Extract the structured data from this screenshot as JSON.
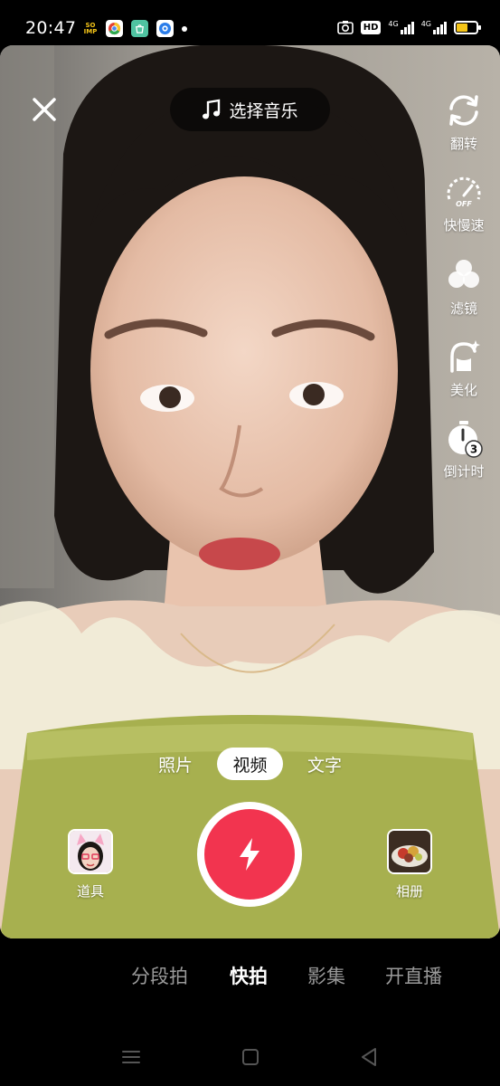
{
  "status_bar": {
    "time": "20:47",
    "soimp_label": "SO IMP",
    "hd_label": "HD",
    "network_1": "4G",
    "network_2": "4G",
    "battery_fraction": 0.55,
    "battery_color": "#f5c518"
  },
  "camera": {
    "close_icon": "close-icon",
    "music_button_label": "选择音乐",
    "music_icon": "music-note-icon",
    "side_tools": [
      {
        "label": "翻转",
        "icon": "flip-camera-icon"
      },
      {
        "label": "快慢速",
        "icon": "speed-gauge-icon",
        "badge": "OFF"
      },
      {
        "label": "滤镜",
        "icon": "filter-icon"
      },
      {
        "label": "美化",
        "icon": "beautify-icon"
      },
      {
        "label": "倒计时",
        "icon": "timer-icon",
        "badge": "3"
      }
    ]
  },
  "mode_tabs": {
    "items": [
      "照片",
      "视频",
      "文字"
    ],
    "active": "视频"
  },
  "capture_row": {
    "props_label": "道具",
    "album_label": "相册",
    "shutter_icon": "lightning-icon",
    "shutter_color": "#f2344f"
  },
  "bottom_tabs": {
    "items": [
      "分段拍",
      "快拍",
      "影集",
      "开直播"
    ],
    "active": "快拍"
  },
  "nav_bar": {
    "icons": [
      "menu-icon",
      "home-icon",
      "back-icon"
    ]
  }
}
